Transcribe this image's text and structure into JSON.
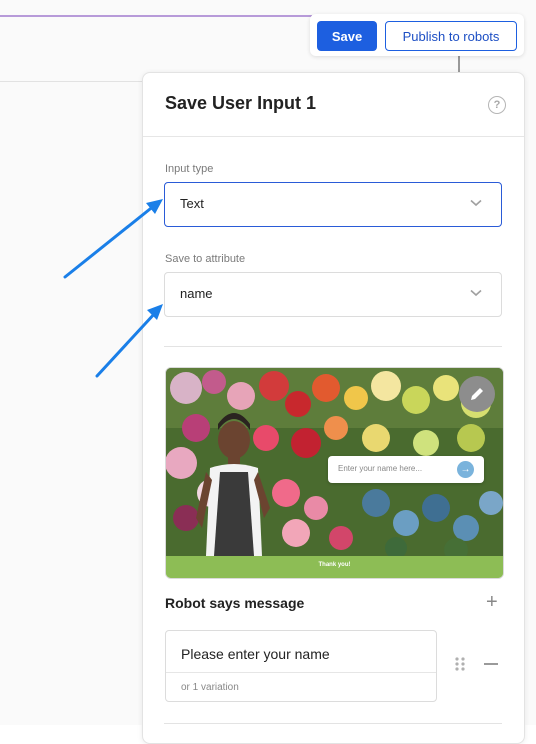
{
  "toolbar": {
    "save_label": "Save",
    "publish_label": "Publish to robots"
  },
  "panel": {
    "title": "Save User Input 1",
    "help_icon": "?"
  },
  "input_type": {
    "label": "Input type",
    "value": "Text"
  },
  "save_attribute": {
    "label": "Save to attribute",
    "value": "name"
  },
  "preview": {
    "input_placeholder": "Enter your name here...",
    "send_icon": "→",
    "thank_text": "Thank you!"
  },
  "robot_message": {
    "section_title": "Robot says message",
    "add_icon": "+",
    "message": "Please enter your name",
    "variations": "or 1 variation"
  },
  "colors": {
    "accent": "#1d5fe0",
    "annotation_arrow": "#1a7fe8",
    "thank_bar": "#8dbd55"
  }
}
